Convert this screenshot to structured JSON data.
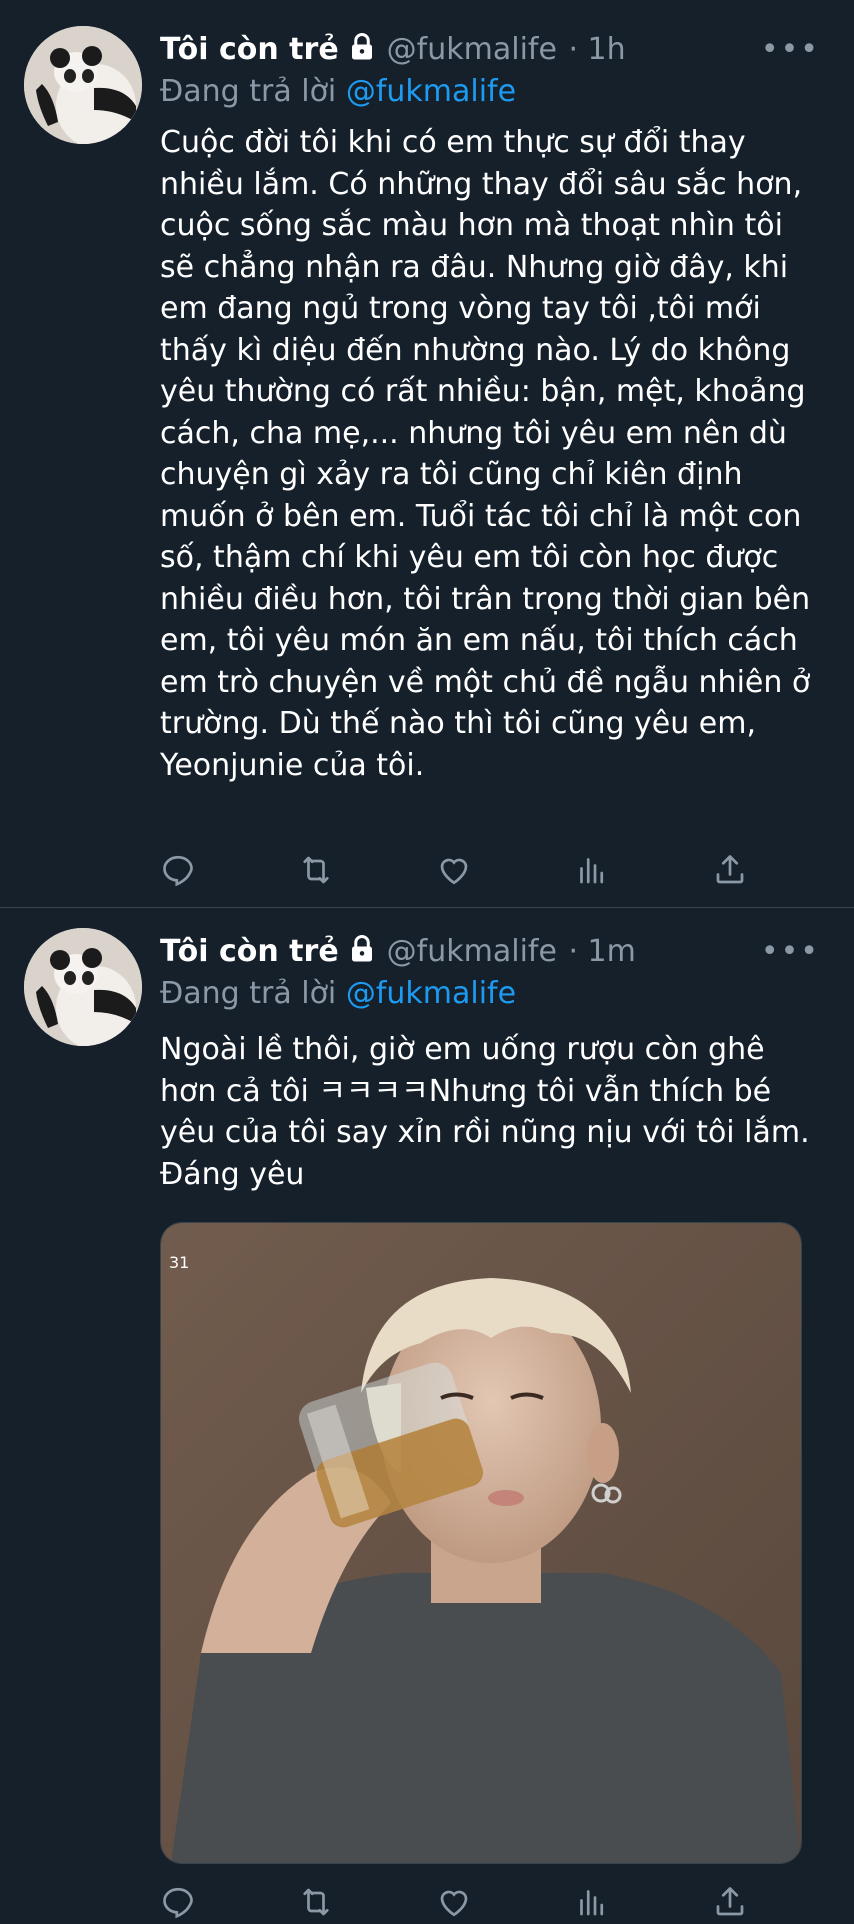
{
  "tweets": [
    {
      "author_name": "Tôi còn trẻ",
      "handle": "@fukmalife",
      "time": "· 1h",
      "reply_prefix": "Đang trả lời",
      "reply_to": "@fukmalife",
      "text": "Cuộc đời tôi khi có em thực sự đổi thay nhiều lắm. Có những thay đổi sâu sắc hơn, cuộc sống sắc màu hơn mà thoạt nhìn tôi sẽ chẳng nhận ra đâu. Nhưng giờ đây, khi em đang ngủ trong vòng tay tôi ,tôi mới thấy kì diệu đến nhường nào. Lý do không yêu thường có rất nhiều: bận, mệt, khoảng cách, cha mẹ,... nhưng tôi yêu em nên dù chuyện gì xảy ra tôi cũng chỉ kiên định muốn ở bên em. Tuổi tác tôi chỉ là một con số, thậm chí khi yêu em tôi còn học được nhiều điều hơn, tôi trân trọng thời gian bên em, tôi yêu món ăn em nấu, tôi thích cách em trò chuyện về một chủ đề ngẫu nhiên ở trường. Dù thế nào thì tôi cũng yêu em, Yeonjunie của tôi."
    },
    {
      "author_name": "Tôi còn trẻ",
      "handle": "@fukmalife",
      "time": "· 1m",
      "reply_prefix": "Đang trả lời",
      "reply_to": "@fukmalife",
      "text": "Ngoài lề thôi, giờ em uống rượu còn ghê hơn cả tôi ㅋㅋㅋㅋNhưng tôi vẫn thích bé yêu của tôi say xỉn rồi nũng nịu với tôi lắm. Đáng yêu",
      "media_label": "31"
    }
  ],
  "icons": [
    "lock-icon",
    "more-icon",
    "reply-icon",
    "retweet-icon",
    "like-icon",
    "analytics-icon",
    "share-icon"
  ],
  "colors": {
    "background": "#15202b",
    "text": "#ffffff",
    "secondary": "#8b98a5",
    "accent": "#1d9bf0",
    "divider": "#38444d"
  }
}
